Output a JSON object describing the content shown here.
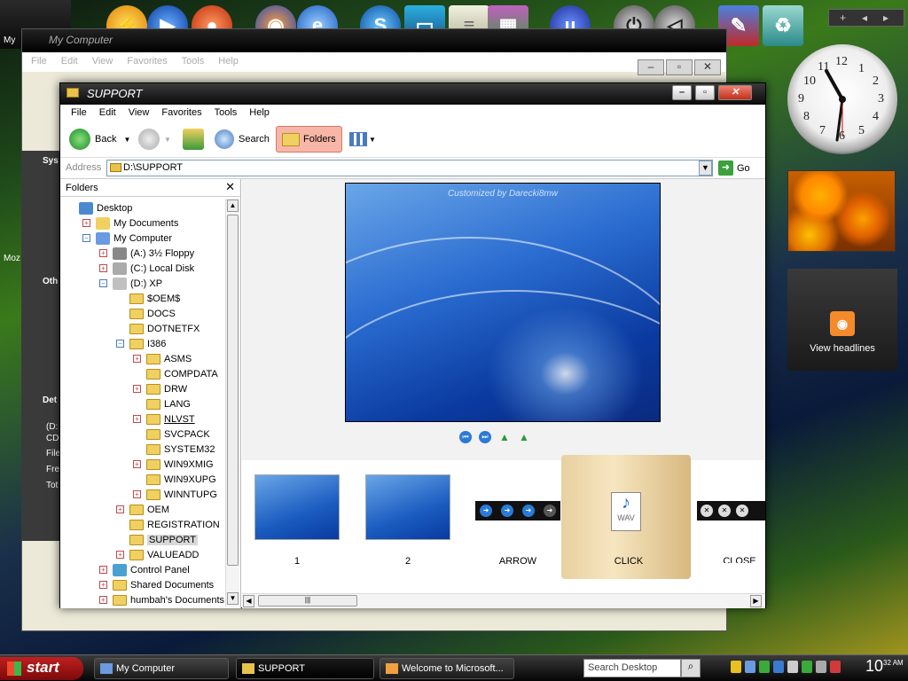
{
  "background_window": {
    "title": "My Computer",
    "menu": [
      "File",
      "Edit",
      "View",
      "Favorites",
      "Tools",
      "Help"
    ],
    "side_fragments": [
      "Sys",
      "Oth",
      "Det",
      "(D:",
      "CD",
      "File",
      "Fre",
      "Tot",
      "Moz",
      "My"
    ]
  },
  "window": {
    "title": "SUPPORT",
    "menu": [
      "File",
      "Edit",
      "View",
      "Favorites",
      "Tools",
      "Help"
    ],
    "toolbar": {
      "back": "Back",
      "search": "Search",
      "folders": "Folders"
    },
    "address": {
      "label": "Address",
      "value": "D:\\SUPPORT",
      "go": "Go"
    },
    "folders_pane": {
      "title": "Folders",
      "close": "✕",
      "tree": [
        {
          "label": "Desktop",
          "level": 0,
          "expander": "none",
          "icon": "desktop"
        },
        {
          "label": "My Documents",
          "level": 1,
          "expander": "plus",
          "icon": "docs"
        },
        {
          "label": "My Computer",
          "level": 1,
          "expander": "minus",
          "icon": "computer"
        },
        {
          "label": "(A:) 3½ Floppy",
          "level": 2,
          "expander": "plus",
          "icon": "floppy"
        },
        {
          "label": "(C:) Local Disk",
          "level": 2,
          "expander": "plus",
          "icon": "disk"
        },
        {
          "label": "(D:) XP",
          "level": 2,
          "expander": "minus",
          "icon": "cd"
        },
        {
          "label": "$OEM$",
          "level": 3,
          "expander": "none",
          "icon": "folder"
        },
        {
          "label": "DOCS",
          "level": 3,
          "expander": "none",
          "icon": "folder"
        },
        {
          "label": "DOTNETFX",
          "level": 3,
          "expander": "none",
          "icon": "folder"
        },
        {
          "label": "I386",
          "level": 3,
          "expander": "minus",
          "icon": "folder"
        },
        {
          "label": "ASMS",
          "level": 4,
          "expander": "plus",
          "icon": "folder"
        },
        {
          "label": "COMPDATA",
          "level": 4,
          "expander": "none",
          "icon": "folder"
        },
        {
          "label": "DRW",
          "level": 4,
          "expander": "plus",
          "icon": "folder"
        },
        {
          "label": "LANG",
          "level": 4,
          "expander": "none",
          "icon": "folder"
        },
        {
          "label": "NLVST",
          "level": 4,
          "expander": "plus",
          "icon": "folder"
        },
        {
          "label": "SVCPACK",
          "level": 4,
          "expander": "none",
          "icon": "folder"
        },
        {
          "label": "SYSTEM32",
          "level": 4,
          "expander": "none",
          "icon": "folder"
        },
        {
          "label": "WIN9XMIG",
          "level": 4,
          "expander": "plus",
          "icon": "folder"
        },
        {
          "label": "WIN9XUPG",
          "level": 4,
          "expander": "none",
          "icon": "folder"
        },
        {
          "label": "WINNTUPG",
          "level": 4,
          "expander": "plus",
          "icon": "folder"
        },
        {
          "label": "OEM",
          "level": 3,
          "expander": "plus",
          "icon": "folder"
        },
        {
          "label": "REGISTRATION",
          "level": 3,
          "expander": "none",
          "icon": "folder"
        },
        {
          "label": "SUPPORT",
          "level": 3,
          "expander": "none",
          "icon": "folder",
          "selected": true
        },
        {
          "label": "VALUEADD",
          "level": 3,
          "expander": "plus",
          "icon": "folder"
        },
        {
          "label": "Control Panel",
          "level": 2,
          "expander": "plus",
          "icon": "control"
        },
        {
          "label": "Shared Documents",
          "level": 2,
          "expander": "plus",
          "icon": "folder"
        },
        {
          "label": "humbah's Documents",
          "level": 2,
          "expander": "plus",
          "icon": "folder"
        }
      ]
    },
    "preview": {
      "caption": "Customized by Darecki8mw"
    },
    "thumbnails": [
      {
        "label": "1",
        "kind": "blue"
      },
      {
        "label": "2",
        "kind": "blue"
      },
      {
        "label": "ARROW",
        "kind": "arrow"
      },
      {
        "label": "CLICK",
        "kind": "wav",
        "file_type": "WAV"
      },
      {
        "label": "CLOSE",
        "kind": "close"
      }
    ]
  },
  "widgets": {
    "rss_label": "View headlines",
    "sidebar_add": "+",
    "clock_numbers": [
      "12",
      "1",
      "2",
      "3",
      "4",
      "5",
      "6",
      "7",
      "8",
      "9",
      "10",
      "11"
    ]
  },
  "taskbar": {
    "start": "start",
    "tasks": [
      "My Computer",
      "SUPPORT",
      "Welcome to Microsoft..."
    ],
    "search_placeholder": "Search Desktop",
    "time": "10",
    "time_suffix": "32 AM"
  }
}
